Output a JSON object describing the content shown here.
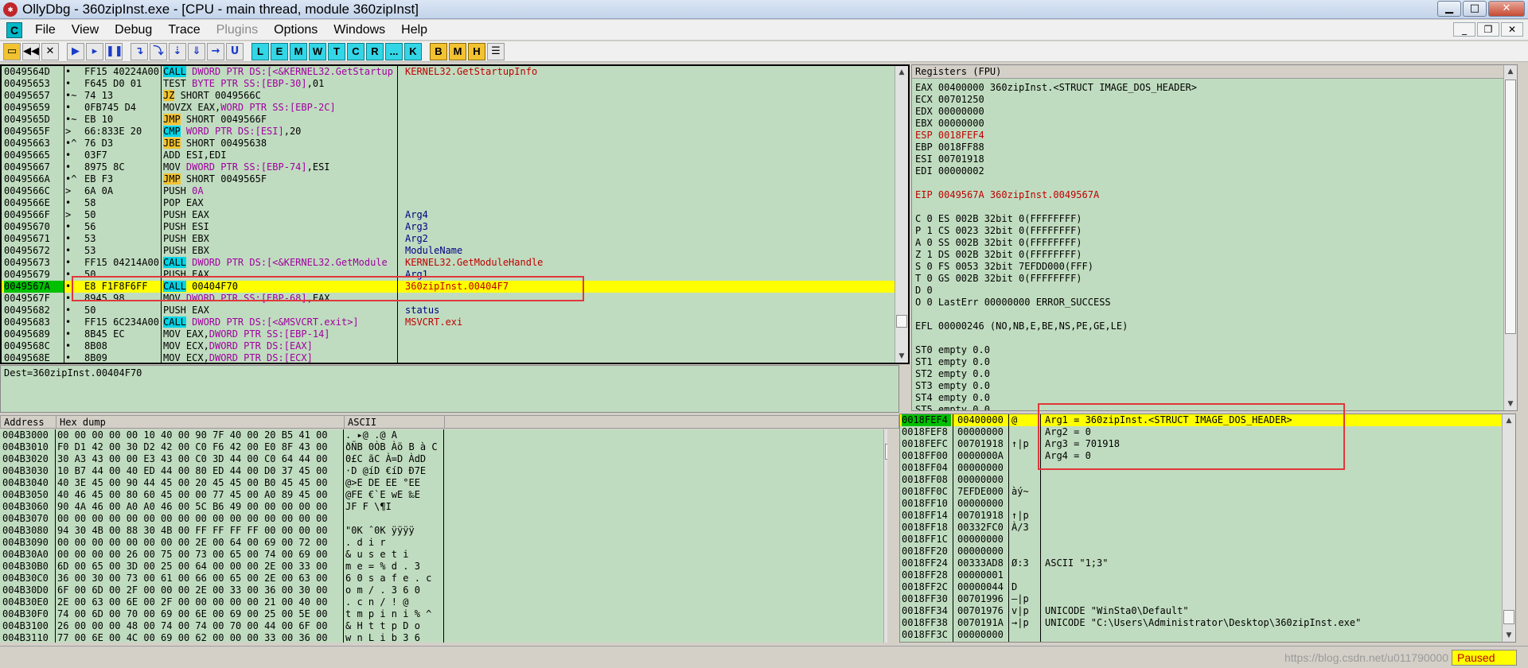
{
  "titlebar": {
    "title": "OllyDbg - 360zipInst.exe - [CPU - main thread, module 360zipInst]"
  },
  "menu": [
    "File",
    "View",
    "Debug",
    "Trace",
    "Plugins",
    "Options",
    "Windows",
    "Help"
  ],
  "toolbar": {
    "letters": [
      "L",
      "E",
      "M",
      "W",
      "T",
      "C",
      "R",
      "...",
      "K"
    ],
    "yellow": [
      "B",
      "M",
      "H"
    ]
  },
  "disasm": [
    {
      "addr": "0049564D",
      "mk": "•",
      "hex": "FF15 40224A00",
      "dis": [
        [
          "k-call",
          "CALL"
        ],
        [
          "mag",
          " DWORD PTR DS:[<&KERNEL32.GetStartup"
        ]
      ],
      "cmt": [
        [
          "red",
          "KERNEL32.GetStartupInfo"
        ]
      ]
    },
    {
      "addr": "00495653",
      "mk": "•",
      "hex": "F645 D0 01",
      "dis": [
        [
          "",
          "TEST "
        ],
        [
          "mag",
          "BYTE PTR SS:[EBP-30]"
        ],
        [
          "",
          ",01"
        ]
      ],
      "cmt": []
    },
    {
      "addr": "00495657",
      "mk": "•~",
      "hex": "74 13",
      "dis": [
        [
          "k-jmp",
          "JZ"
        ],
        [
          "",
          " SHORT 0049566C"
        ]
      ],
      "cmt": []
    },
    {
      "addr": "00495659",
      "mk": "•",
      "hex": "0FB745 D4",
      "dis": [
        [
          "",
          "MOVZX EAX,"
        ],
        [
          "mag",
          "WORD PTR SS:[EBP-2C]"
        ]
      ],
      "cmt": []
    },
    {
      "addr": "0049565D",
      "mk": "•~",
      "hex": "EB 10",
      "dis": [
        [
          "k-jmp",
          "JMP"
        ],
        [
          "",
          " SHORT 0049566F"
        ]
      ],
      "cmt": []
    },
    {
      "addr": "0049565F",
      "mk": ">",
      "hex": "66:833E 20",
      "dis": [
        [
          "k-call",
          "CMP"
        ],
        [
          "mag",
          " WORD PTR DS:[ESI]"
        ],
        [
          "",
          ",20"
        ]
      ],
      "cmt": []
    },
    {
      "addr": "00495663",
      "mk": "•^",
      "hex": "76 D3",
      "dis": [
        [
          "k-jmp",
          "JBE"
        ],
        [
          "",
          " SHORT 00495638"
        ]
      ],
      "cmt": []
    },
    {
      "addr": "00495665",
      "mk": "•",
      "hex": "03F7",
      "dis": [
        [
          "",
          "ADD ESI,EDI"
        ]
      ],
      "cmt": []
    },
    {
      "addr": "00495667",
      "mk": "•",
      "hex": "8975 8C",
      "dis": [
        [
          "",
          "MOV "
        ],
        [
          "mag",
          "DWORD PTR SS:[EBP-74]"
        ],
        [
          "",
          ",ESI"
        ]
      ],
      "cmt": []
    },
    {
      "addr": "0049566A",
      "mk": "•^",
      "hex": "EB F3",
      "dis": [
        [
          "k-jmp",
          "JMP"
        ],
        [
          "",
          " SHORT 0049565F"
        ]
      ],
      "cmt": []
    },
    {
      "addr": "0049566C",
      "mk": ">",
      "hex": "6A 0A",
      "dis": [
        [
          "",
          "PUSH "
        ],
        [
          "mag",
          "0A"
        ]
      ],
      "cmt": []
    },
    {
      "addr": "0049566E",
      "mk": "•",
      "hex": "58",
      "dis": [
        [
          "",
          "POP EAX"
        ]
      ],
      "cmt": []
    },
    {
      "addr": "0049566F",
      "mk": ">",
      "hex": "50",
      "dis": [
        [
          "",
          "PUSH EAX"
        ]
      ],
      "cmt": [
        [
          "navy",
          "Arg4"
        ]
      ]
    },
    {
      "addr": "00495670",
      "mk": "•",
      "hex": "56",
      "dis": [
        [
          "",
          "PUSH ESI"
        ]
      ],
      "cmt": [
        [
          "navy",
          "Arg3"
        ]
      ]
    },
    {
      "addr": "00495671",
      "mk": "•",
      "hex": "53",
      "dis": [
        [
          "",
          "PUSH EBX"
        ]
      ],
      "cmt": [
        [
          "navy",
          "Arg2"
        ]
      ]
    },
    {
      "addr": "00495672",
      "mk": "•",
      "hex": "53",
      "dis": [
        [
          "",
          "PUSH EBX"
        ]
      ],
      "cmt": [
        [
          "navy",
          "ModuleName"
        ]
      ]
    },
    {
      "addr": "00495673",
      "mk": "•",
      "hex": "FF15 04214A00",
      "dis": [
        [
          "k-call",
          "CALL"
        ],
        [
          "mag",
          " DWORD PTR DS:[<&KERNEL32.GetModule"
        ]
      ],
      "cmt": [
        [
          "red",
          "KERNEL32.GetModuleHandle"
        ]
      ]
    },
    {
      "addr": "00495679",
      "mk": "•",
      "hex": "50",
      "dis": [
        [
          "",
          "PUSH EAX"
        ]
      ],
      "cmt": [
        [
          "navy",
          "Arg1"
        ]
      ]
    },
    {
      "addr": "0049567A",
      "mk": "•",
      "hex": "E8 F1F8F6FF",
      "dis": [
        [
          "k-call",
          "CALL"
        ],
        [
          "",
          " 00404F70"
        ]
      ],
      "cmt": [
        [
          "red",
          "360zipInst.00404F7"
        ]
      ],
      "sel": true
    },
    {
      "addr": "0049567F",
      "mk": "•",
      "hex": "8945 98",
      "dis": [
        [
          "",
          "MOV "
        ],
        [
          "mag",
          "DWORD PTR SS:[EBP-68]"
        ],
        [
          "",
          ",EAX"
        ]
      ],
      "cmt": []
    },
    {
      "addr": "00495682",
      "mk": "•",
      "hex": "50",
      "dis": [
        [
          "",
          "PUSH EAX"
        ]
      ],
      "cmt": [
        [
          "navy",
          "status"
        ]
      ]
    },
    {
      "addr": "00495683",
      "mk": "•",
      "hex": "FF15 6C234A00",
      "dis": [
        [
          "k-call",
          "CALL"
        ],
        [
          "mag",
          " DWORD PTR DS:[<&MSVCRT.exit>]"
        ]
      ],
      "cmt": [
        [
          "red",
          "MSVCRT.exi"
        ]
      ]
    },
    {
      "addr": "00495689",
      "mk": "•",
      "hex": "8B45 EC",
      "dis": [
        [
          "",
          "MOV EAX,"
        ],
        [
          "mag",
          "DWORD PTR SS:[EBP-14]"
        ]
      ],
      "cmt": []
    },
    {
      "addr": "0049568C",
      "mk": "•",
      "hex": "8B08",
      "dis": [
        [
          "",
          "MOV ECX,"
        ],
        [
          "mag",
          "DWORD PTR DS:[EAX]"
        ]
      ],
      "cmt": []
    },
    {
      "addr": "0049568E",
      "mk": "•",
      "hex": "8B09",
      "dis": [
        [
          "",
          "MOV ECX,"
        ],
        [
          "mag",
          "DWORD PTR DS:[ECX]"
        ]
      ],
      "cmt": []
    }
  ],
  "info": "Dest=360zipInst.00404F70",
  "registers": {
    "title": "Registers (FPU)",
    "lines": [
      "EAX 00400000 360zipInst.<STRUCT IMAGE_DOS_HEADER>",
      "ECX 00701250",
      "EDX 00000000",
      "EBX 00000000",
      "ESP 0018FEF4",
      "EBP 0018FF88",
      "ESI 00701918",
      "EDI 00000002",
      "",
      "EIP 0049567A 360zipInst.0049567A",
      "",
      "C 0  ES 002B 32bit 0(FFFFFFFF)",
      "P 1  CS 0023 32bit 0(FFFFFFFF)",
      "A 0  SS 002B 32bit 0(FFFFFFFF)",
      "Z 1  DS 002B 32bit 0(FFFFFFFF)",
      "S 0  FS 0053 32bit 7EFDD000(FFF)",
      "T 0  GS 002B 32bit 0(FFFFFFFF)",
      "D 0",
      "O 0  LastErr 00000000 ERROR_SUCCESS",
      "",
      "EFL 00000246 (NO,NB,E,BE,NS,PE,GE,LE)",
      "",
      "ST0 empty 0.0",
      "ST1 empty 0.0",
      "ST2 empty 0.0",
      "ST3 empty 0.0",
      "ST4 empty 0.0",
      "ST5 empty 0.0",
      "ST6 empty 0.0",
      "ST7 empty 0.0"
    ]
  },
  "dump": {
    "headers": [
      "Address",
      "Hex dump",
      "ASCII"
    ],
    "rows": [
      [
        "004B3000",
        "00 00 00 00 00 10 40 00 90 7F 40 00 20 B5 41 00",
        ".   ▸@ .@  A"
      ],
      [
        "004B3010",
        "F0 D1 42 00 30 D2 42 00 C0 F6 42 00 E0 8F 43 00",
        "ðÑB 0ÒB Àö B à C"
      ],
      [
        "004B3020",
        "30 A3 43 00 00 E3 43 00 C0 3D 44 00 C0 64 44 00",
        "0£C  ãC À=D ÀdD"
      ],
      [
        "004B3030",
        "10 B7 44 00 40 ED 44 00 80 ED 44 00 D0 37 45 00",
        "·D @íD €íD Ð7E"
      ],
      [
        "004B3040",
        "40 3E 45 00 90 44 45 00 20 45 45 00 B0 45 45 00",
        "@>E  DE  EE °EE"
      ],
      [
        "004B3050",
        "40 46 45 00 80 60 45 00 00 77 45 00 A0 89 45 00",
        "@FE €`E  wE  ‰E"
      ],
      [
        "004B3060",
        "90 4A 46 00 A0 A0 46 00 5C B6 49 00 00 00 00 00",
        " JF   F \\¶I"
      ],
      [
        "004B3070",
        "00 00 00 00 00 00 00 00 00 00 00 00 00 00 00 00",
        ""
      ],
      [
        "004B3080",
        "94 30 4B 00 88 30 4B 00 FF FF FF FF 00 00 00 00",
        "\"0K ˆ0K ÿÿÿÿ"
      ],
      [
        "004B3090",
        "00 00 00 00 00 00 00 00 2E 00 64 00 69 00 72 00",
        "        . d i r"
      ],
      [
        "004B30A0",
        "00 00 00 00 26 00 75 00 73 00 65 00 74 00 69 00",
        "    & u s e t i"
      ],
      [
        "004B30B0",
        "6D 00 65 00 3D 00 25 00 64 00 00 00 2E 00 33 00",
        "m e = % d   . 3"
      ],
      [
        "004B30C0",
        "36 00 30 00 73 00 61 00 66 00 65 00 2E 00 63 00",
        "6 0 s a f e . c"
      ],
      [
        "004B30D0",
        "6F 00 6D 00 2F 00 00 00 2E 00 33 00 36 00 30 00",
        "o m /   . 3 6 0"
      ],
      [
        "004B30E0",
        "2E 00 63 00 6E 00 2F 00 00 00 00 00 21 00 40 00",
        ". c n /     ! @"
      ],
      [
        "004B30F0",
        "74 00 6D 00 70 00 69 00 6E 00 69 00 25 00 5E 00",
        "t m p i n i % ^"
      ],
      [
        "004B3100",
        "26 00 00 00 48 00 74 00 74 00 70 00 44 00 6F 00",
        "&   H t t p D o"
      ],
      [
        "004B3110",
        "77 00 6E 00 4C 00 69 00 62 00 00 00 33 00 36 00",
        "w n L i b   3 6"
      ]
    ]
  },
  "stack": [
    {
      "a": "0018FEF4",
      "v": "00400000",
      "x": "@",
      "c": "Arg1 = 360zipInst.<STRUCT IMAGE_DOS_HEADER>",
      "sel": true
    },
    {
      "a": "0018FEF8",
      "v": "00000000",
      "x": "",
      "c": "Arg2 = 0"
    },
    {
      "a": "0018FEFC",
      "v": "00701918",
      "x": "↑|p",
      "c": "Arg3 = 701918"
    },
    {
      "a": "0018FF00",
      "v": "0000000A",
      "x": "",
      "c": "Arg4 = 0"
    },
    {
      "a": "0018FF04",
      "v": "00000000",
      "x": "",
      "c": ""
    },
    {
      "a": "0018FF08",
      "v": "00000000",
      "x": "",
      "c": ""
    },
    {
      "a": "0018FF0C",
      "v": "7EFDE000",
      "x": "àý~",
      "c": ""
    },
    {
      "a": "0018FF10",
      "v": "00000000",
      "x": "",
      "c": ""
    },
    {
      "a": "0018FF14",
      "v": "00701918",
      "x": "↑|p",
      "c": ""
    },
    {
      "a": "0018FF18",
      "v": "00332FC0",
      "x": "À/3",
      "c": ""
    },
    {
      "a": "0018FF1C",
      "v": "00000000",
      "x": "",
      "c": ""
    },
    {
      "a": "0018FF20",
      "v": "00000000",
      "x": "",
      "c": ""
    },
    {
      "a": "0018FF24",
      "v": "00333AD8",
      "x": "Ø:3",
      "c": "ASCII \"1;3\""
    },
    {
      "a": "0018FF28",
      "v": "00000001",
      "x": "",
      "c": ""
    },
    {
      "a": "0018FF2C",
      "v": "00000044",
      "x": "D",
      "c": ""
    },
    {
      "a": "0018FF30",
      "v": "00701996",
      "x": "–|p",
      "c": ""
    },
    {
      "a": "0018FF34",
      "v": "00701976",
      "x": "v|p",
      "c": "UNICODE \"WinSta0\\Default\""
    },
    {
      "a": "0018FF38",
      "v": "0070191A",
      "x": "→|p",
      "c": "UNICODE \"C:\\Users\\Administrator\\Desktop\\360zipInst.exe\""
    },
    {
      "a": "0018FF3C",
      "v": "00000000",
      "x": "",
      "c": ""
    }
  ],
  "statusbar": {
    "watermark": "https://blog.csdn.net/u011790000",
    "state": "Paused"
  },
  "colors": {
    "pane_bg": "#c0dcc0",
    "highlight": "#ffff00",
    "eip": "#00c000",
    "annotation": "#e0383c"
  }
}
